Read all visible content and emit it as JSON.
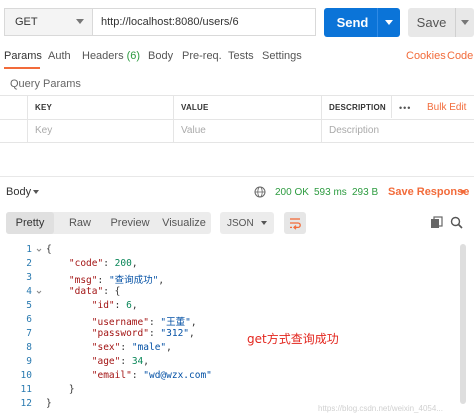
{
  "request": {
    "method": "GET",
    "url": "http://localhost:8080/users/6",
    "send_label": "Send",
    "save_label": "Save"
  },
  "request_tabs": {
    "params": "Params",
    "auth": "Auth",
    "headers": "Headers",
    "headers_count": "(6)",
    "body": "Body",
    "prereq": "Pre-req.",
    "tests": "Tests",
    "settings": "Settings",
    "cookies": "Cookies",
    "code": "Code"
  },
  "query_params": {
    "title": "Query Params",
    "headers": [
      "KEY",
      "VALUE",
      "DESCRIPTION"
    ],
    "bulk_edit": "Bulk Edit",
    "more": "•••",
    "placeholders": [
      "Key",
      "Value",
      "Description"
    ]
  },
  "response": {
    "body_label": "Body",
    "status": "200 OK",
    "time": "593 ms",
    "size": "293 B",
    "save_response": "Save Response",
    "views": [
      "Pretty",
      "Raw",
      "Preview",
      "Visualize"
    ],
    "format": "JSON",
    "line_numbers": [
      "1",
      "2",
      "3",
      "4",
      "5",
      "6",
      "7",
      "8",
      "9",
      "10",
      "11",
      "12"
    ],
    "json": {
      "code_key": "\"code\"",
      "code_val": "200",
      "msg_key": "\"msg\"",
      "msg_val": "\"查询成功\"",
      "data_key": "\"data\"",
      "id_key": "\"id\"",
      "id_val": "6",
      "username_key": "\"username\"",
      "username_val": "\"王董\"",
      "password_key": "\"password\"",
      "password_val": "\"312\"",
      "sex_key": "\"sex\"",
      "sex_val": "\"male\"",
      "age_key": "\"age\"",
      "age_val": "34",
      "email_key": "\"email\"",
      "email_val": "\"wd@wzx.com\""
    },
    "annotation": "get方式查询成功",
    "watermark": "https://blog.csdn.net/weixin_4054..."
  },
  "colors": {
    "accent": "#f26b3a",
    "send": "#0b74d8",
    "ok": "#2c9b3f",
    "annotation": "#e3261e"
  }
}
